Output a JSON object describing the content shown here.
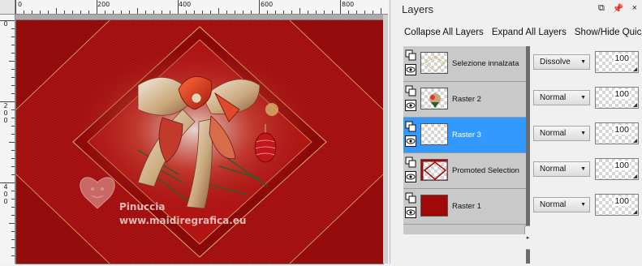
{
  "ruler": {
    "top_ticks": [
      "0",
      "200",
      "400",
      "600",
      "800"
    ],
    "left_ticks": [
      [
        "0"
      ],
      [
        "2",
        "0",
        "0"
      ],
      [
        "4",
        "0",
        "0"
      ]
    ]
  },
  "canvas": {
    "watermark_name": "Pinuccia",
    "watermark_site": "www.maidiregrafica.eu",
    "colors": {
      "background_red": "#a10f0f",
      "dark_red": "#7a0707",
      "gold": "#d6b36a"
    }
  },
  "palette": {
    "title": "Layers",
    "controls": [
      "⧉",
      "📌",
      "×"
    ],
    "toolbar": {
      "collapse_all": "Collapse All Layers",
      "expand_all": "Expand All Layers",
      "show_hide": "Show/Hide Quick"
    },
    "layers": [
      {
        "name": "Selezione innalzata",
        "blend": "Dissolve",
        "opacity": "100",
        "thumb": "transparent",
        "selected": false
      },
      {
        "name": "Raster 2",
        "blend": "Normal",
        "opacity": "100",
        "thumb": "bow",
        "selected": false
      },
      {
        "name": "Raster 3",
        "blend": "Normal",
        "opacity": "100",
        "thumb": "transparent",
        "selected": true
      },
      {
        "name": "Promoted Selection",
        "blend": "Normal",
        "opacity": "100",
        "thumb": "frame",
        "selected": false
      },
      {
        "name": "Raster 1",
        "blend": "Normal",
        "opacity": "100",
        "thumb": "red",
        "selected": false
      }
    ],
    "selection_color": "#3399ff",
    "divider_knob": "▸"
  }
}
